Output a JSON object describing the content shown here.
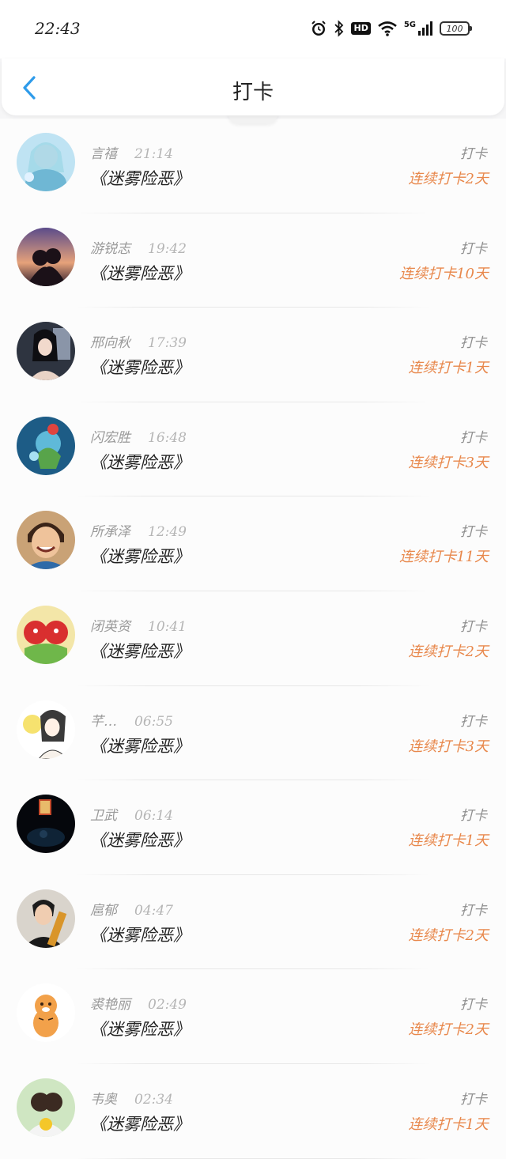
{
  "status_bar": {
    "time": "22:43",
    "hd": "HD",
    "network": "5G",
    "battery": "100"
  },
  "header": {
    "title": "打卡",
    "back_icon": "chevron-left-icon",
    "accent_color": "#2e9bea"
  },
  "list": {
    "streak_color": "#e8884c",
    "items": [
      {
        "name": "言禧",
        "time": "21:14",
        "book": "《迷雾险恶》",
        "action": "打卡",
        "streak": "连续打卡2天"
      },
      {
        "name": "游锐志",
        "time": "19:42",
        "book": "《迷雾险恶》",
        "action": "打卡",
        "streak": "连续打卡10天"
      },
      {
        "name": "邢向秋",
        "time": "17:39",
        "book": "《迷雾险恶》",
        "action": "打卡",
        "streak": "连续打卡1天"
      },
      {
        "name": "闪宏胜",
        "time": "16:48",
        "book": "《迷雾险恶》",
        "action": "打卡",
        "streak": "连续打卡3天"
      },
      {
        "name": "所承泽",
        "time": "12:49",
        "book": "《迷雾险恶》",
        "action": "打卡",
        "streak": "连续打卡11天"
      },
      {
        "name": "闭英资",
        "time": "10:41",
        "book": "《迷雾险恶》",
        "action": "打卡",
        "streak": "连续打卡2天"
      },
      {
        "name": "芊…",
        "time": "06:55",
        "book": "《迷雾险恶》",
        "action": "打卡",
        "streak": "连续打卡3天"
      },
      {
        "name": "卫武",
        "time": "06:14",
        "book": "《迷雾险恶》",
        "action": "打卡",
        "streak": "连续打卡1天"
      },
      {
        "name": "扈郁",
        "time": "04:47",
        "book": "《迷雾险恶》",
        "action": "打卡",
        "streak": "连续打卡2天"
      },
      {
        "name": "裘艳丽",
        "time": "02:49",
        "book": "《迷雾险恶》",
        "action": "打卡",
        "streak": "连续打卡2天"
      },
      {
        "name": "韦奥",
        "time": "02:34",
        "book": "《迷雾险恶》",
        "action": "打卡",
        "streak": "连续打卡1天"
      }
    ]
  }
}
